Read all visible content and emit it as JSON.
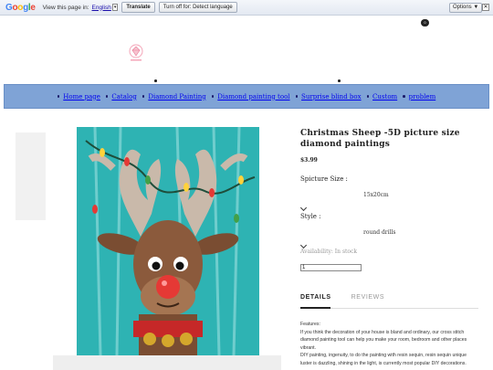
{
  "translate_bar": {
    "logo": "Google",
    "prompt": "View this page in:",
    "language": "English",
    "translate_label": "Translate",
    "turn_off_label": "Turn off for: Detect language",
    "options_label": "Options ▼",
    "close_glyph": "✕"
  },
  "header": {
    "cart_count": "0"
  },
  "nav": {
    "items": [
      {
        "label": "Home page"
      },
      {
        "label": "Catalog"
      },
      {
        "label": "Diamond Painting"
      },
      {
        "label": "Diamond painting tool"
      },
      {
        "label": "Surprise blind box"
      },
      {
        "label": "Custom"
      },
      {
        "label": "problem"
      }
    ]
  },
  "product": {
    "title": "Christmas Sheep -5D picture size diamond paintings",
    "price": "$3.99",
    "size_label": "Spicture Size :",
    "size_value": "15x20cm",
    "style_label": "Style :",
    "style_value": "round drills",
    "availability": "Availability: In stock",
    "quantity": "1"
  },
  "tabs": {
    "details": "DETAILS",
    "reviews": "REVIEWS"
  },
  "description": {
    "heading": "Features:",
    "p1": "If you think the decoration of your house is bland and ordinary, our cross stitch diamond painting tool can help you make your room, bedroom and other places vibrant.",
    "p2": "DIY painting, ingenuity, to do the painting with resin sequin, resin sequin unique luster is dazzling, shining in the light, is currently most popular DIY decorations."
  },
  "colors": {
    "nav_bg": "#7fa3d6",
    "painting_bg": "#2eb3b3",
    "link": "#0000ee"
  }
}
